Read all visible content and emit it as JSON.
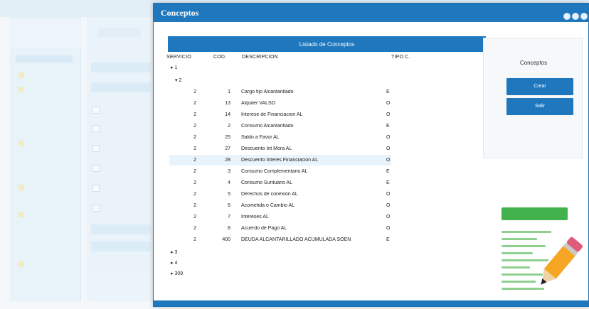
{
  "window": {
    "title": "Conceptos"
  },
  "list": {
    "header_title": "Listado de Conceptos",
    "columns": {
      "servicio": "SERVICIO",
      "cod": "COD.",
      "descripcion": "DESCRIPCION",
      "tipo": "TIPO C."
    },
    "groups": [
      {
        "label": "1"
      },
      {
        "label": "2"
      },
      {
        "label": "3"
      },
      {
        "label": "4"
      },
      {
        "label": "309"
      }
    ],
    "rows": [
      {
        "servicio": "2",
        "cod": "1",
        "descripcion": "Cargo fijo Alcantarillado",
        "tipo": "E"
      },
      {
        "servicio": "2",
        "cod": "13",
        "descripcion": "Alquiler VALSO",
        "tipo": "O"
      },
      {
        "servicio": "2",
        "cod": "14",
        "descripcion": "Interese de Financiacion AL",
        "tipo": "O"
      },
      {
        "servicio": "2",
        "cod": "2",
        "descripcion": "Consumo Alcantarillado",
        "tipo": "E"
      },
      {
        "servicio": "2",
        "cod": "25",
        "descripcion": "Saldo a Favor AL",
        "tipo": "O"
      },
      {
        "servicio": "2",
        "cod": "27",
        "descripcion": "Descuento Int Mora AL",
        "tipo": "O"
      },
      {
        "servicio": "2",
        "cod": "28",
        "descripcion": "Descuento Interes Financiacion AL",
        "tipo": "O"
      },
      {
        "servicio": "2",
        "cod": "3",
        "descripcion": "Consumo Complementario AL",
        "tipo": "E"
      },
      {
        "servicio": "2",
        "cod": "4",
        "descripcion": "Consumo Suntuario AL",
        "tipo": "E"
      },
      {
        "servicio": "2",
        "cod": "5",
        "descripcion": "Derechos de conexion AL",
        "tipo": "O"
      },
      {
        "servicio": "2",
        "cod": "6",
        "descripcion": "Acometida o Cambio AL",
        "tipo": "O"
      },
      {
        "servicio": "2",
        "cod": "7",
        "descripcion": "Intereses AL",
        "tipo": "O"
      },
      {
        "servicio": "2",
        "cod": "8",
        "descripcion": "Acuerdo de Pago AL",
        "tipo": "O"
      },
      {
        "servicio": "2",
        "cod": "400",
        "descripcion": "DEUDA ALCANTARILLADO ACUMULADA SOEN",
        "tipo": "E"
      }
    ],
    "selected_row_index": 6
  },
  "side_panel": {
    "title": "Conceptos",
    "buttons": [
      {
        "label": "Crear"
      },
      {
        "label": "Salir"
      }
    ]
  },
  "colors": {
    "accent": "#1f78be",
    "titlebar": "#1f78be",
    "selected_row": "#e8f3fb",
    "illustration_green": "#42b34c"
  },
  "icons": {
    "window_controls": [
      "minimize-icon",
      "maximize-icon",
      "close-icon"
    ],
    "illustration": "pencil-icon"
  }
}
